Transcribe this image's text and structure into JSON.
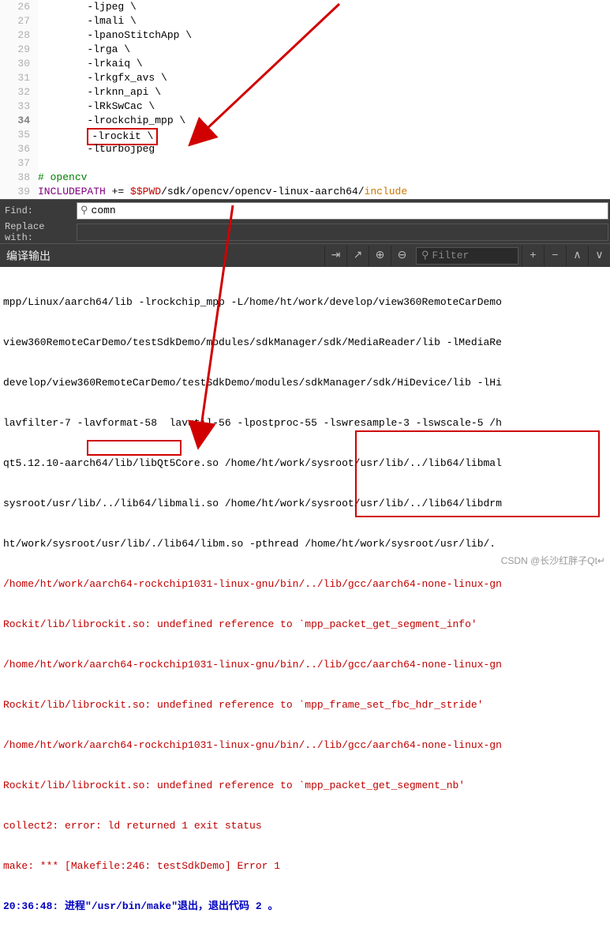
{
  "editor": {
    "lines": [
      {
        "num": "26",
        "text": "        -ljpeg \\"
      },
      {
        "num": "27",
        "text": "        -lmali \\"
      },
      {
        "num": "28",
        "text": "        -lpanoStitchApp \\"
      },
      {
        "num": "29",
        "text": "        -lrga \\"
      },
      {
        "num": "30",
        "text": "        -lrkaiq \\"
      },
      {
        "num": "31",
        "text": "        -lrkgfx_avs \\"
      },
      {
        "num": "32",
        "text": "        -lrknn_api \\"
      },
      {
        "num": "33",
        "text": "        -lRkSwCac \\"
      },
      {
        "num": "34",
        "text": "        -lrockchip_mpp \\",
        "bold": true
      },
      {
        "num": "35",
        "text_pre": "        ",
        "boxed": "-lrockit \\",
        "text_post": ""
      },
      {
        "num": "36",
        "text": "        -lturbojpeg"
      },
      {
        "num": "37",
        "text": ""
      }
    ],
    "comment_line": {
      "num": "38",
      "prefix": "# ",
      "text": "opencv"
    },
    "include_line": {
      "num": "39",
      "var": "INCLUDEPATH",
      "op": " += ",
      "pwd": "$$PWD",
      "path1": "/sdk/opencv/opencv-linux-aarch64/",
      "path2": "include"
    }
  },
  "find": {
    "label": "Find:",
    "value": "comn",
    "replace_label": "Replace with:"
  },
  "output_title": "编译输出",
  "filter_placeholder": "Filter",
  "output_lines": [
    "mpp/Linux/aarch64/lib -lrockchip_mpp -L/home/ht/work/develop/view360RemoteCarDemo",
    "view360RemoteCarDemo/testSdkDemo/modules/sdkManager/sdk/MediaReader/lib -lMediaRe",
    "develop/view360RemoteCarDemo/testSdkDemo/modules/sdkManager/sdk/HiDevice/lib -lHi",
    "lavfilter-7 -lavformat-58  lavutil-56 -lpostproc-55 -lswresample-3 -lswscale-5 /h",
    "qt5.12.10-aarch64/lib/libQt5Core.so /home/ht/work/sysroot/usr/lib/../lib64/libmal",
    "sysroot/usr/lib/../lib64/libmali.so /home/ht/work/sysroot/usr/lib/../lib64/libdrm",
    "ht/work/sysroot/usr/lib/./lib64/libm.so -pthread /home/ht/work/sysroot/usr/lib/."
  ],
  "error_lines": [
    "/home/ht/work/aarch64-rockchip1031-linux-gnu/bin/../lib/gcc/aarch64-none-linux-gn",
    "Rockit/lib/librockit.so: undefined reference to `mpp_packet_get_segment_info'",
    "/home/ht/work/aarch64-rockchip1031-linux-gnu/bin/../lib/gcc/aarch64-none-linux-gn",
    "Rockit/lib/librockit.so: undefined reference to `mpp_frame_set_fbc_hdr_stride'",
    "/home/ht/work/aarch64-rockchip1031-linux-gnu/bin/../lib/gcc/aarch64-none-linux-gn",
    "Rockit/lib/librockit.so: undefined reference to `mpp_packet_get_segment_nb'",
    "collect2: error: ld returned 1 exit status",
    "make: *** [Makefile:246: testSdkDemo] Error 1"
  ],
  "final_line": {
    "time": "20:36:48: ",
    "text": "进程\"/usr/bin/make\"退出，退出代码 2 。"
  },
  "watermark": "CSDN @长沙红胖子Qt↵"
}
